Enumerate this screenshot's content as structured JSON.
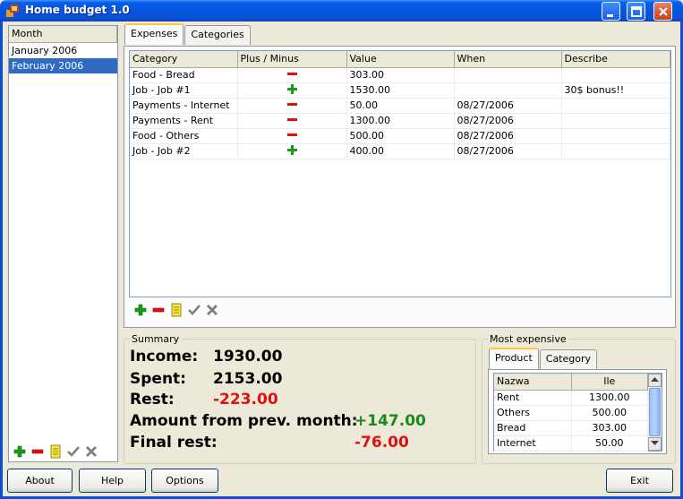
{
  "window": {
    "title": "Home budget 1.0"
  },
  "months": {
    "header": "Month",
    "items": [
      "January 2006",
      "February 2006"
    ],
    "selected_index": 1
  },
  "main_tabs": [
    {
      "label": "Expenses",
      "active": true
    },
    {
      "label": "Categories",
      "active": false
    }
  ],
  "expenses": {
    "columns": [
      "Category",
      "Plus / Minus",
      "Value",
      "When",
      "Describe"
    ],
    "rows": [
      {
        "category": "Food - Bread",
        "sign": "minus",
        "value": "303.00",
        "when": "",
        "describe": ""
      },
      {
        "category": "Job - Job #1",
        "sign": "plus",
        "value": "1530.00",
        "when": "",
        "describe": "30$ bonus!!"
      },
      {
        "category": "Payments - Internet",
        "sign": "minus",
        "value": "50.00",
        "when": "08/27/2006",
        "describe": ""
      },
      {
        "category": "Payments - Rent",
        "sign": "minus",
        "value": "1300.00",
        "when": "08/27/2006",
        "describe": ""
      },
      {
        "category": "Food - Others",
        "sign": "minus",
        "value": "500.00",
        "when": "08/27/2006",
        "describe": ""
      },
      {
        "category": "Job - Job #2",
        "sign": "plus",
        "value": "400.00",
        "when": "08/27/2006",
        "describe": ""
      }
    ]
  },
  "summary": {
    "label": "Summary",
    "income_label": "Income:",
    "income_value": "1930.00",
    "spent_label": "Spent:",
    "spent_value": "2153.00",
    "rest_label": "Rest:",
    "rest_value": "-223.00",
    "prev_label": "Amount from prev. month:",
    "prev_value": "+147.00",
    "final_label": "Final rest:",
    "final_value": "-76.00"
  },
  "most_expensive": {
    "label": "Most expensive",
    "tabs": [
      {
        "label": "Product",
        "active": true
      },
      {
        "label": "Category",
        "active": false
      }
    ],
    "columns": [
      "Nazwa",
      "Ile"
    ],
    "rows": [
      {
        "name": "Rent",
        "amount": "1300.00"
      },
      {
        "name": "Others",
        "amount": "500.00"
      },
      {
        "name": "Bread",
        "amount": "303.00"
      },
      {
        "name": "Internet",
        "amount": "50.00"
      }
    ]
  },
  "buttons": {
    "about": "About",
    "help": "Help",
    "options": "Options",
    "exit": "Exit"
  },
  "colors": {
    "plus": "#1a9a1a",
    "minus": "#e01010",
    "selection": "#316ac5",
    "title_bar": "#0a5ce8"
  },
  "icons": [
    "add-icon",
    "remove-icon",
    "edit-icon",
    "accept-icon",
    "cancel-icon"
  ]
}
